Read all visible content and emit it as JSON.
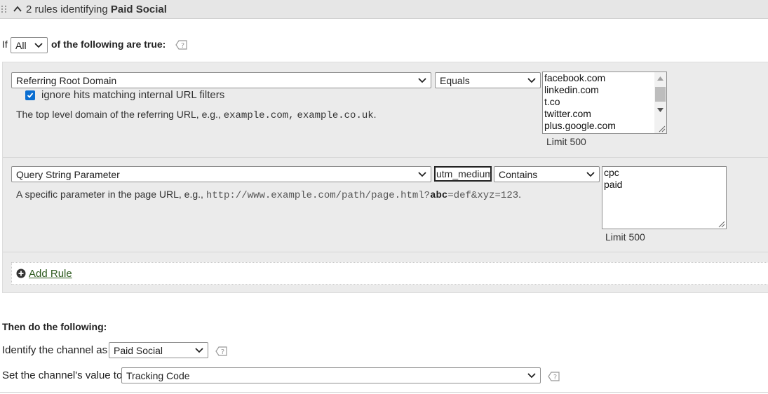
{
  "header": {
    "count_text": "2 rules identifying",
    "channel_name": "Paid Social"
  },
  "condition": {
    "if_label": "If",
    "match_select": "All",
    "suffix": "of the following are true:"
  },
  "rules": [
    {
      "dimension": "Referring Root Domain",
      "operator": "Equals",
      "checkbox_label": "ignore hits matching internal URL filters",
      "checkbox_checked": true,
      "description_prefix": "The top level domain of the referring URL, e.g.,",
      "example_1": "example.com",
      "example_sep": ",",
      "example_2": "example.co.uk",
      "description_suffix": ".",
      "values": [
        "facebook.com",
        "linkedin.com",
        "t.co",
        "twitter.com",
        "plus.google.com"
      ],
      "limit": "Limit 500"
    },
    {
      "dimension": "Query String Parameter",
      "parameter": "utm_medium",
      "operator": "Contains",
      "description_prefix": "A specific parameter in the page URL, e.g.,",
      "url_part_1": "http://www.example.com/path/page.html?",
      "url_part_bold": "abc",
      "url_part_2": "=def&xyz=123",
      "description_suffix": ".",
      "values": [
        "cpc",
        "paid"
      ],
      "limit": "Limit 500"
    }
  ],
  "add_rule_label": "Add Rule",
  "then": {
    "title": "Then do the following:",
    "identify_label": "Identify the channel as",
    "identify_value": "Paid Social",
    "set_label": "Set the channel's value to",
    "set_value": "Tracking Code"
  },
  "icons": {
    "header_toggle": "chevron-up-icon",
    "help": "help-icon",
    "add": "plus-circle-icon",
    "dropdown": "chevron-down-icon",
    "check": "checkmark-icon"
  },
  "colors": {
    "checkbox": "#0a6ed1",
    "link": "#2d5a1e",
    "panel": "#ebebeb",
    "header": "#e6e6e6"
  }
}
